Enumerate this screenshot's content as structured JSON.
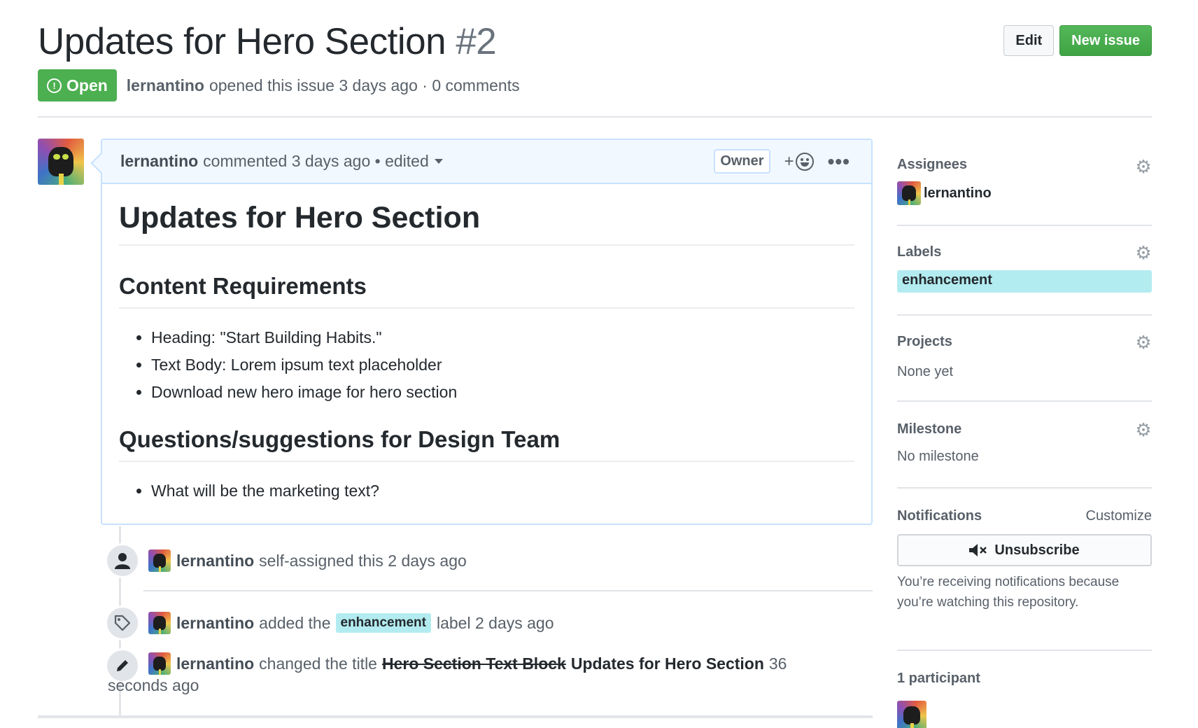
{
  "header": {
    "title": "Updates for Hero Section",
    "number": "#2",
    "state": "Open",
    "author": "lernantino",
    "meta": "opened this issue 3 days ago · 0 comments",
    "edit_label": "Edit",
    "new_issue_label": "New issue"
  },
  "comment": {
    "author": "lernantino",
    "meta": "commented 3 days ago • edited",
    "owner_badge": "Owner",
    "reaction_plus": "+",
    "dots": "•••",
    "h1": "Updates for Hero Section",
    "h2_requirements": "Content Requirements",
    "requirements": [
      "Heading: \"Start Building Habits.\"",
      "Text Body: Lorem ipsum text placeholder",
      "Download new hero image for hero section"
    ],
    "h2_questions": "Questions/suggestions for Design Team",
    "questions": [
      "What will be the marketing text?"
    ]
  },
  "events": [
    {
      "author": "lernantino",
      "text": "self-assigned this 2 days ago"
    },
    {
      "author": "lernantino",
      "pre": "added the",
      "label": "enhancement",
      "post": "label 2 days ago"
    },
    {
      "author": "lernantino",
      "pre": "changed the title",
      "old_title": "Hero Section Text Block",
      "new_title": "Updates for Hero Section",
      "post": "36",
      "line2": "seconds ago"
    }
  ],
  "sidebar": {
    "assignees_title": "Assignees",
    "assignee": "lernantino",
    "labels_title": "Labels",
    "label": "enhancement",
    "projects_title": "Projects",
    "projects_value": "None yet",
    "milestone_title": "Milestone",
    "milestone_value": "No milestone",
    "notifications_title": "Notifications",
    "customize": "Customize",
    "unsubscribe": "Unsubscribe",
    "notif_text": "You’re receiving notifications because you’re watching this repository.",
    "participants_title": "1 participant"
  },
  "colors": {
    "open_green": "#4caf50",
    "label_cyan": "#b3ecf0",
    "comment_border": "#c8e1ff"
  }
}
